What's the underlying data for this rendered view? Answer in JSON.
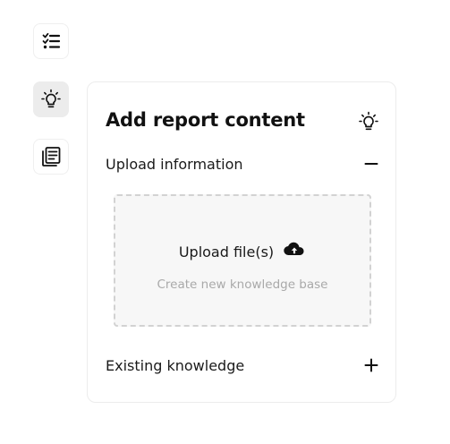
{
  "rail": {
    "items": [
      {
        "icon": "checklist-icon",
        "active": false
      },
      {
        "icon": "lightbulb-icon",
        "active": true
      },
      {
        "icon": "document-stack-icon",
        "active": false
      }
    ]
  },
  "panel": {
    "title": "Add report content",
    "title_icon": "lightbulb-icon",
    "upload_section": {
      "label": "Upload information",
      "expanded": true,
      "toggle_icon": "minus-icon",
      "dropzone": {
        "label": "Upload file(s)",
        "icon": "cloud-upload-icon",
        "sublabel": "Create new knowledge base"
      }
    },
    "existing_section": {
      "label": "Existing knowledge",
      "expanded": false,
      "toggle_icon": "plus-icon"
    }
  },
  "colors": {
    "active_bg": "#ececec",
    "dropzone_bg": "#f7f7f7",
    "dropzone_border": "#d2d2d2",
    "muted_text": "#a9a9a9"
  }
}
